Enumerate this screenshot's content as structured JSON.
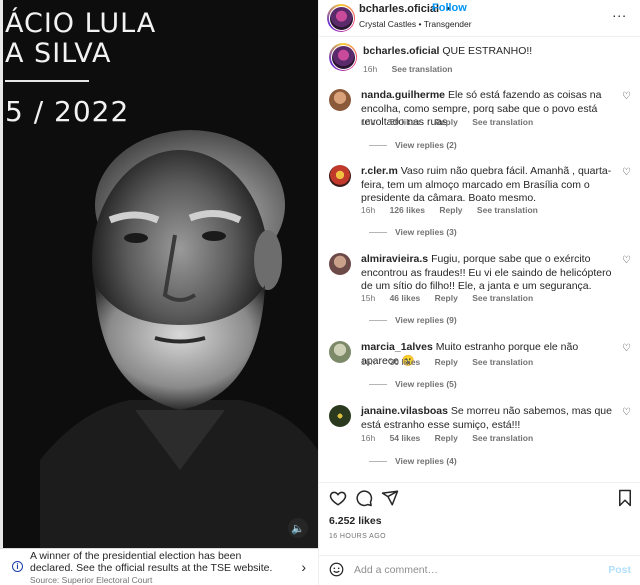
{
  "media": {
    "line1": "ÁCIO LULA",
    "line2": "A SILVA",
    "year": "5 / 2022",
    "mute_icon": "speaker-muted-icon"
  },
  "notice": {
    "message": "A winner of the presidential election has been declared. See the official results at the TSE website.",
    "source": "Source: Superior Electoral Court",
    "info_icon": "info-icon",
    "chevron_icon": "chevron-right-icon"
  },
  "header": {
    "username": "bcharles.oficial",
    "separator": "•",
    "follow_label": "Follow",
    "subline": "Crystal Castles • Transgender",
    "more_label": "..."
  },
  "caption": {
    "username": "bcharles.oficial",
    "text": "QUE ESTRANHO!!",
    "time": "16h",
    "see_translation": "See translation"
  },
  "comments": [
    {
      "username": "nanda.guilherme",
      "text": "Ele só está fazendo as coisas na encolha, como sempre, porq sabe que o povo está revoltado nas ruas.",
      "time": "16h",
      "likes": "59 likes",
      "reply": "Reply",
      "see_translation": "See translation",
      "view_replies": "View replies (2)",
      "avatar_color": "#8a5a3a"
    },
    {
      "username": "r.cler.m",
      "text": "Vaso ruim não quebra fácil. Amanhã , quarta- feira, tem um almoço marcado em Brasília com o presidente da câmara. Boato mesmo.",
      "time": "16h",
      "likes": "126 likes",
      "reply": "Reply",
      "see_translation": "See translation",
      "view_replies": "View replies (3)",
      "avatar_color": "#c0392b"
    },
    {
      "username": "almiravieira.s",
      "text": "Fugiu, porque sabe que o exército encontrou as fraudes!! Eu vi ele saindo de helicóptero de um sítio do filho!! Ele, a janta e um segurança.",
      "time": "15h",
      "likes": "46 likes",
      "reply": "Reply",
      "see_translation": "See translation",
      "view_replies": "View replies (9)",
      "avatar_color": "#6b4a48"
    },
    {
      "username": "marcia_1alves",
      "text": "Muito estranho porque ele não aparece 😮",
      "time": "16h",
      "likes": "30 likes",
      "reply": "Reply",
      "see_translation": "See translation",
      "view_replies": "View replies (5)",
      "avatar_color": "#7d8a6a"
    },
    {
      "username": "janaine.vilasboas",
      "text": "Se morreu não sabemos, mas que está estranho esse sumiço, está!!!",
      "time": "16h",
      "likes": "54 likes",
      "reply": "Reply",
      "see_translation": "See translation",
      "view_replies": "View replies (4)",
      "avatar_color": "#2b3a1e"
    }
  ],
  "actions": {
    "like_icon": "heart-icon",
    "comment_icon": "comment-icon",
    "share_icon": "send-icon",
    "save_icon": "bookmark-icon",
    "likes": "6.252 likes",
    "ago": "16 HOURS AGO"
  },
  "add_comment": {
    "emoji_icon": "smiley-icon",
    "placeholder": "Add a comment…",
    "post_label": "Post"
  },
  "colors": {
    "accent": "#0095f6",
    "text": "#262626",
    "muted": "#737373",
    "post_disabled": "#b2dffc"
  }
}
